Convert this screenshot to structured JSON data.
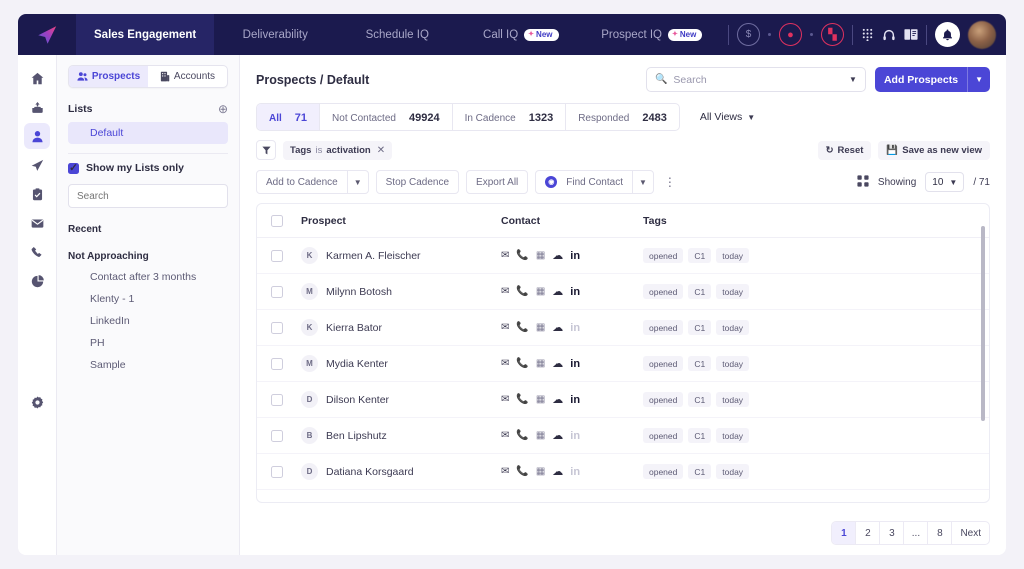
{
  "colors": {
    "nav_bg": "#1b1a4e",
    "nav_active": "#262566",
    "accent": "#4b46d6",
    "accent_light": "#ebe9fc",
    "page_bg": "#f3f2f8",
    "danger": "#e0315f"
  },
  "topnav": {
    "logo": "paper-plane-logo",
    "items": [
      {
        "label": "Sales Engagement",
        "active": true,
        "badge": ""
      },
      {
        "label": "Deliverability",
        "active": false,
        "badge": ""
      },
      {
        "label": "Schedule IQ",
        "active": false,
        "badge": ""
      },
      {
        "label": "Call IQ",
        "active": false,
        "badge": "New"
      },
      {
        "label": "Prospect IQ",
        "active": false,
        "badge": "New"
      }
    ],
    "right_icons": [
      "dollar-circle-icon",
      "person-circle-icon",
      "chart-circle-icon",
      "dialpad-icon",
      "headset-icon",
      "book-icon",
      "bell-icon",
      "avatar"
    ]
  },
  "rail": {
    "items": [
      {
        "name": "home-icon",
        "glyph": "⌂",
        "active": false
      },
      {
        "name": "inbox-icon",
        "glyph": "⤒",
        "active": false
      },
      {
        "name": "prospects-icon",
        "glyph": "♟",
        "active": true
      },
      {
        "name": "cadence-icon",
        "glyph": "➤",
        "active": false
      },
      {
        "name": "tasks-icon",
        "glyph": "☑",
        "active": false
      },
      {
        "name": "mail-icon",
        "glyph": "✉",
        "active": false
      },
      {
        "name": "calls-icon",
        "glyph": "☎",
        "active": false
      },
      {
        "name": "reports-icon",
        "glyph": "◔",
        "active": false
      },
      {
        "name": "settings-icon",
        "glyph": "⚙",
        "active": false
      }
    ]
  },
  "lists_panel": {
    "tabs": [
      {
        "label": "Prospects",
        "icon": "people-icon",
        "active": true
      },
      {
        "label": "Accounts",
        "icon": "building-icon",
        "active": false
      }
    ],
    "lists_header": "Lists",
    "add_list_icon": "plus-circle-icon",
    "default_list": "Default",
    "show_my_lists_label": "Show my Lists only",
    "show_my_lists_checked": true,
    "search_placeholder": "Search",
    "groups": [
      {
        "title": "Recent",
        "items": []
      },
      {
        "title": "Not Approaching",
        "items": [
          "Contact after 3 months",
          "Klenty - 1",
          "LinkedIn",
          "PH",
          "Sample"
        ]
      }
    ]
  },
  "main": {
    "breadcrumb": "Prospects / Default",
    "search_placeholder": "Search",
    "add_prospects_label": "Add Prospects",
    "stats": [
      {
        "label": "All",
        "value": "71",
        "active": true
      },
      {
        "label": "Not Contacted",
        "value": "49924",
        "active": false
      },
      {
        "label": "In Cadence",
        "value": "1323",
        "active": false
      },
      {
        "label": "Responded",
        "value": "2483",
        "active": false
      }
    ],
    "views_label": "All Views",
    "filter_chip": {
      "field": "Tags",
      "op": "is",
      "value": "activation"
    },
    "reset_label": "Reset",
    "save_view_label": "Save as new view",
    "toolbar": {
      "add_to_cadence": "Add to Cadence",
      "stop_cadence": "Stop Cadence",
      "export_all": "Export All",
      "find_contact": "Find Contact"
    },
    "showing_label": "Showing",
    "page_size": "10",
    "total_label": "/ 71",
    "table": {
      "columns": [
        "Prospect",
        "Contact",
        "Tags"
      ],
      "rows": [
        {
          "initial": "K",
          "name": "Karmen A. Fleischer",
          "linkedin": true,
          "tags": [
            "opened",
            "C1",
            "today"
          ]
        },
        {
          "initial": "M",
          "name": "Milynn Botosh",
          "linkedin": true,
          "tags": [
            "opened",
            "C1",
            "today"
          ]
        },
        {
          "initial": "K",
          "name": "Kierra Bator",
          "linkedin": false,
          "tags": [
            "opened",
            "C1",
            "today"
          ]
        },
        {
          "initial": "M",
          "name": "Mydia Kenter",
          "linkedin": true,
          "tags": [
            "opened",
            "C1",
            "today"
          ]
        },
        {
          "initial": "D",
          "name": "Dilson Kenter",
          "linkedin": true,
          "tags": [
            "opened",
            "C1",
            "today"
          ]
        },
        {
          "initial": "B",
          "name": "Ben Lipshutz",
          "linkedin": false,
          "tags": [
            "opened",
            "C1",
            "today"
          ]
        },
        {
          "initial": "D",
          "name": "Datiana Korsgaard",
          "linkedin": false,
          "tags": [
            "opened",
            "C1",
            "today"
          ]
        }
      ],
      "contact_icons": [
        "email-icon",
        "phone-icon",
        "card-icon",
        "cloud-icon",
        "linkedin-icon"
      ]
    },
    "pagination": [
      "1",
      "2",
      "3",
      "...",
      "8",
      "Next"
    ]
  }
}
